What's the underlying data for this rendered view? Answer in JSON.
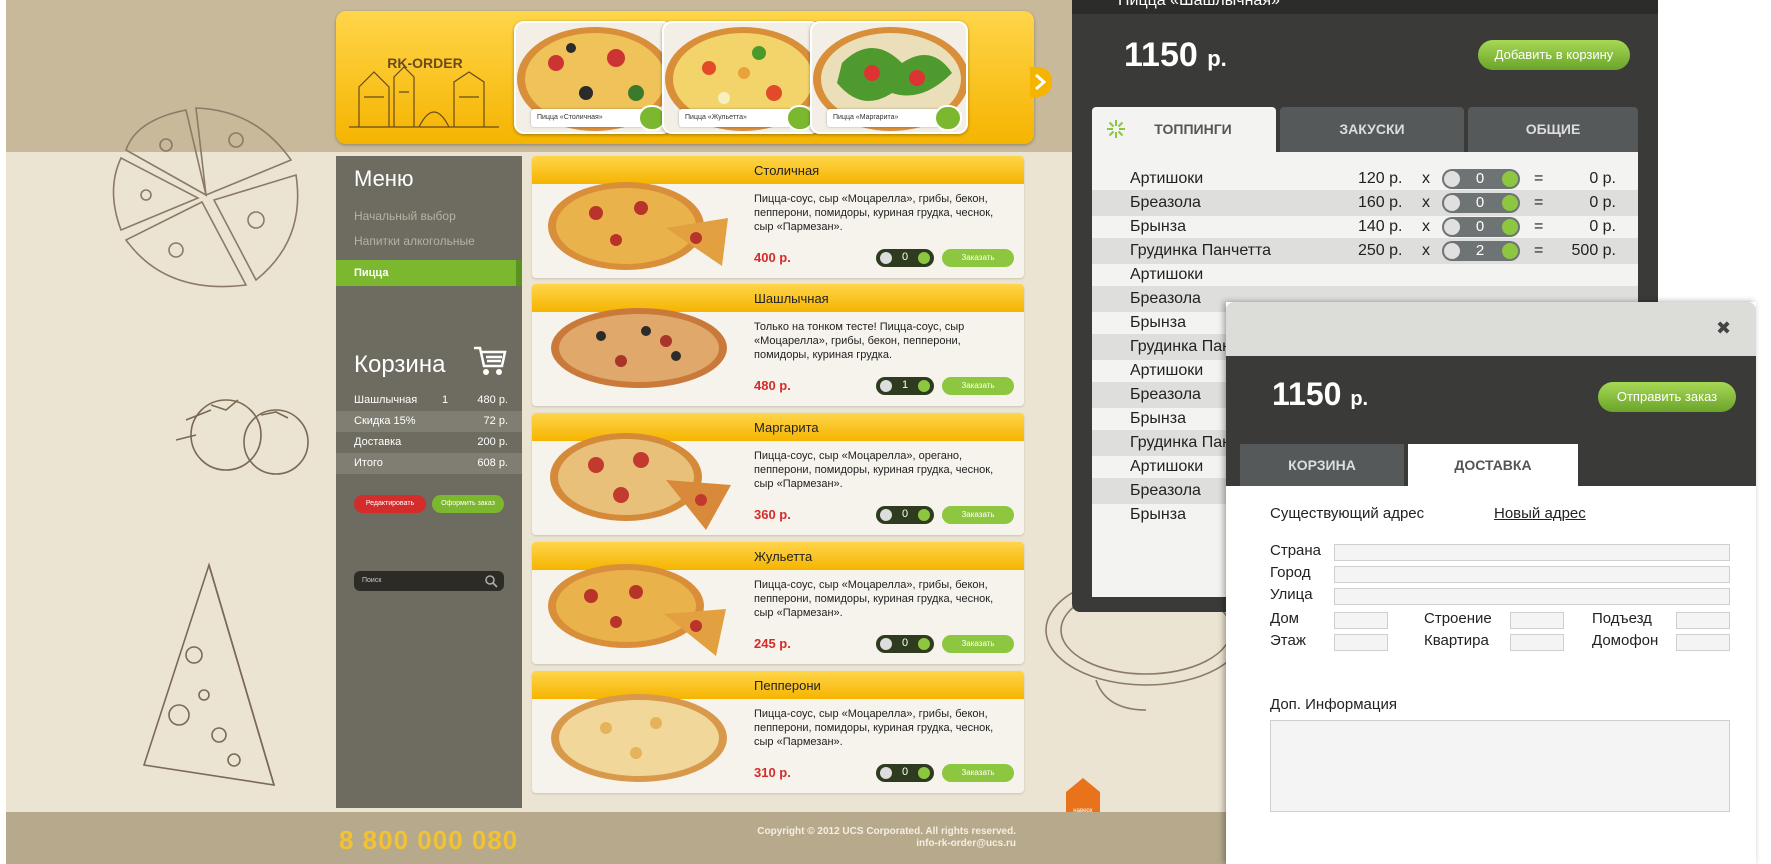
{
  "site": {
    "banner": {
      "logo_text": "RK-ORDER",
      "slides": [
        {
          "label": "Пицца «Столичная»"
        },
        {
          "label": "Пицца «Жульетта»"
        },
        {
          "label": "Пицца «Маргарита»"
        }
      ]
    },
    "menu": {
      "title": "Меню",
      "items": [
        "Начальный выбор",
        "Напитки алкогольные"
      ],
      "active_item": "Пицца"
    },
    "cart": {
      "title": "Корзина",
      "rows": [
        {
          "name": "Шашлычная",
          "qty": "1",
          "price": "480 р."
        },
        {
          "name": "Скидка 15%",
          "qty": "",
          "price": "72 р."
        },
        {
          "name": "Доставка",
          "qty": "",
          "price": "200 р."
        },
        {
          "name": "Итого",
          "qty": "",
          "price": "608 р."
        }
      ],
      "edit_label": "Редактировать",
      "checkout_label": "Оформить заказ"
    },
    "search": {
      "placeholder": "Поиск"
    },
    "products": [
      {
        "name": "Столичная",
        "desc": "Пицца-соус, сыр «Моцарелла», грибы, бекон, пепперони, помидоры, куриная грудка, чеснок, сыр «Пармезан».",
        "price": "400 р.",
        "qty": "0",
        "order": "Заказать"
      },
      {
        "name": "Шашлычная",
        "desc": "Только на тонком тесте! Пицца-соус, сыр «Моцарелла», грибы, бекон, пепперони, помидоры, куриная грудка.",
        "price": "480 р.",
        "qty": "1",
        "order": "Заказать"
      },
      {
        "name": "Маргарита",
        "desc": "Пицца-соус, сыр «Моцарелла», орегано, пепперони, помидоры, куриная грудка, чеснок, сыр «Пармезан».",
        "price": "360 р.",
        "qty": "0",
        "order": "Заказать"
      },
      {
        "name": "Жульетта",
        "desc": "Пицца-соус, сыр «Моцарелла», грибы, бекон, пепперони, помидоры, куриная грудка, чеснок, сыр «Пармезан».",
        "price": "245 р.",
        "qty": "0",
        "order": "Заказать"
      },
      {
        "name": "Пепперони",
        "desc": "Пицца-соус, сыр «Моцарелла», грибы, бекон, пепперони, помидоры, куриная грудка, чеснок, сыр «Пармезан».",
        "price": "310 р.",
        "qty": "0",
        "order": "Заказать"
      }
    ],
    "footer": {
      "phone": "8 800 000 080",
      "copyright": "Copyright © 2012 UCS Corporated. All rights reserved.",
      "email": "info-rk-order@ucs.ru",
      "up_label": "наверх"
    }
  },
  "toppings_panel": {
    "top_item": "Пицца «Шашлычная»",
    "total": "1150",
    "currency": "р.",
    "add_to_cart": "Добавить в корзину",
    "tabs": [
      "ТОППИНГИ",
      "ЗАКУСКИ",
      "ОБЩИЕ"
    ],
    "rows": [
      {
        "name": "Артишоки",
        "price": "120 р.",
        "x": "x",
        "qty": "0",
        "eq": "=",
        "sum": "0 р."
      },
      {
        "name": "Бреазола",
        "price": "160 р.",
        "x": "x",
        "qty": "0",
        "eq": "=",
        "sum": "0 р."
      },
      {
        "name": "Брынза",
        "price": "140 р.",
        "x": "x",
        "qty": "0",
        "eq": "=",
        "sum": "0 р."
      },
      {
        "name": "Грудинка Панчетта",
        "price": "250 р.",
        "x": "x",
        "qty": "2",
        "eq": "=",
        "sum": "500 р."
      },
      {
        "name": "Артишоки"
      },
      {
        "name": "Бреазола"
      },
      {
        "name": "Брынза"
      },
      {
        "name": "Грудинка Панчетта"
      },
      {
        "name": "Артишоки"
      },
      {
        "name": "Бреазола"
      },
      {
        "name": "Брынза"
      },
      {
        "name": "Грудинка Панчетта"
      },
      {
        "name": "Артишоки"
      },
      {
        "name": "Бреазола"
      },
      {
        "name": "Брынза"
      }
    ]
  },
  "delivery_panel": {
    "close": "✖",
    "total": "1150",
    "currency": "р.",
    "send_order": "Отправить заказ",
    "tabs": [
      "КОРЗИНА",
      "ДОСТАВКА"
    ],
    "existing_address": "Существующий адрес",
    "new_address": "Новый адрес",
    "fields": {
      "country": "Страна",
      "city": "Город",
      "street": "Улица",
      "house": "Дом",
      "building": "Строение",
      "entrance": "Подъезд",
      "floor": "Этаж",
      "apartment": "Квартира",
      "intercom": "Домофон"
    },
    "extra_info": "Доп. Информация"
  }
}
